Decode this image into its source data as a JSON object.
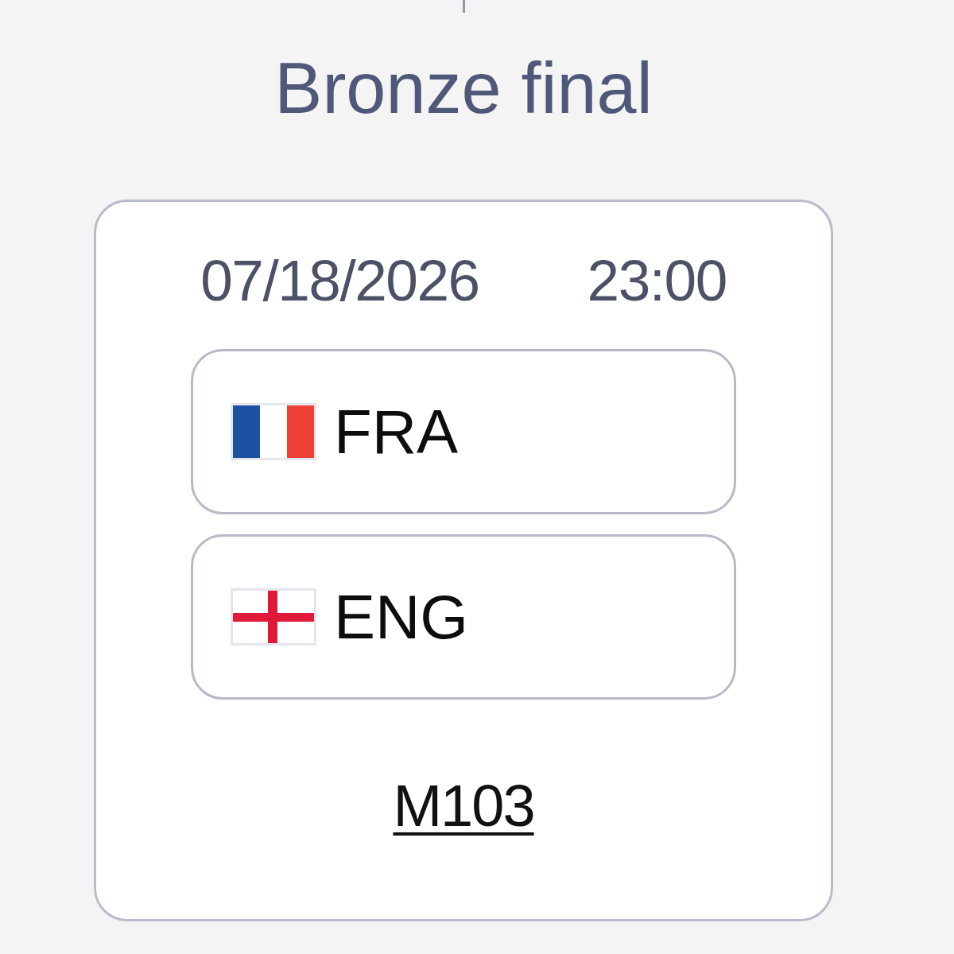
{
  "round": {
    "title": "Bronze final"
  },
  "match": {
    "date": "07/18/2026",
    "time": "23:00",
    "teams": [
      {
        "code": "FRA",
        "kind": "tricolor"
      },
      {
        "code": "ENG",
        "kind": "cross"
      }
    ],
    "match_id": "M103"
  }
}
